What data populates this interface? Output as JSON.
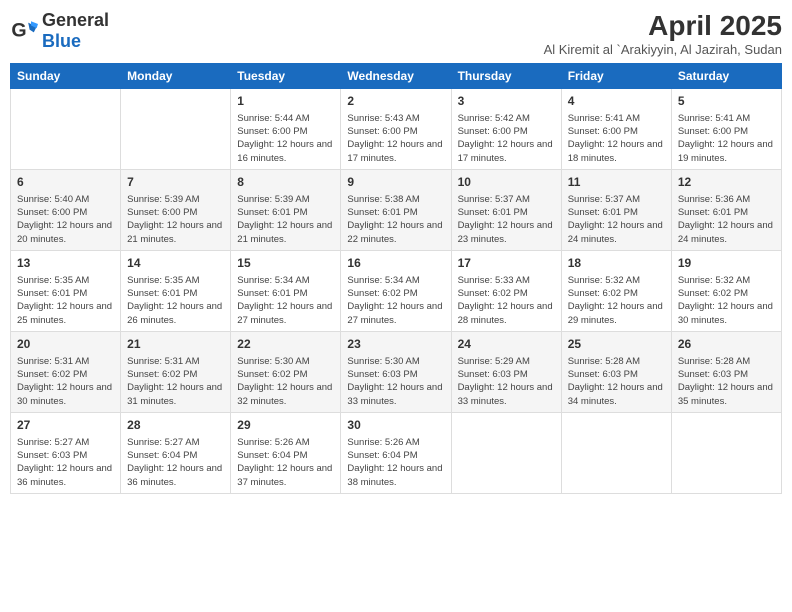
{
  "header": {
    "logo_general": "General",
    "logo_blue": "Blue",
    "month_title": "April 2025",
    "location": "Al Kiremit al `Arakiyyin, Al Jazirah, Sudan"
  },
  "weekdays": [
    "Sunday",
    "Monday",
    "Tuesday",
    "Wednesday",
    "Thursday",
    "Friday",
    "Saturday"
  ],
  "weeks": [
    [
      {
        "day": "",
        "info": ""
      },
      {
        "day": "",
        "info": ""
      },
      {
        "day": "1",
        "info": "Sunrise: 5:44 AM\nSunset: 6:00 PM\nDaylight: 12 hours and 16 minutes."
      },
      {
        "day": "2",
        "info": "Sunrise: 5:43 AM\nSunset: 6:00 PM\nDaylight: 12 hours and 17 minutes."
      },
      {
        "day": "3",
        "info": "Sunrise: 5:42 AM\nSunset: 6:00 PM\nDaylight: 12 hours and 17 minutes."
      },
      {
        "day": "4",
        "info": "Sunrise: 5:41 AM\nSunset: 6:00 PM\nDaylight: 12 hours and 18 minutes."
      },
      {
        "day": "5",
        "info": "Sunrise: 5:41 AM\nSunset: 6:00 PM\nDaylight: 12 hours and 19 minutes."
      }
    ],
    [
      {
        "day": "6",
        "info": "Sunrise: 5:40 AM\nSunset: 6:00 PM\nDaylight: 12 hours and 20 minutes."
      },
      {
        "day": "7",
        "info": "Sunrise: 5:39 AM\nSunset: 6:00 PM\nDaylight: 12 hours and 21 minutes."
      },
      {
        "day": "8",
        "info": "Sunrise: 5:39 AM\nSunset: 6:01 PM\nDaylight: 12 hours and 21 minutes."
      },
      {
        "day": "9",
        "info": "Sunrise: 5:38 AM\nSunset: 6:01 PM\nDaylight: 12 hours and 22 minutes."
      },
      {
        "day": "10",
        "info": "Sunrise: 5:37 AM\nSunset: 6:01 PM\nDaylight: 12 hours and 23 minutes."
      },
      {
        "day": "11",
        "info": "Sunrise: 5:37 AM\nSunset: 6:01 PM\nDaylight: 12 hours and 24 minutes."
      },
      {
        "day": "12",
        "info": "Sunrise: 5:36 AM\nSunset: 6:01 PM\nDaylight: 12 hours and 24 minutes."
      }
    ],
    [
      {
        "day": "13",
        "info": "Sunrise: 5:35 AM\nSunset: 6:01 PM\nDaylight: 12 hours and 25 minutes."
      },
      {
        "day": "14",
        "info": "Sunrise: 5:35 AM\nSunset: 6:01 PM\nDaylight: 12 hours and 26 minutes."
      },
      {
        "day": "15",
        "info": "Sunrise: 5:34 AM\nSunset: 6:01 PM\nDaylight: 12 hours and 27 minutes."
      },
      {
        "day": "16",
        "info": "Sunrise: 5:34 AM\nSunset: 6:02 PM\nDaylight: 12 hours and 27 minutes."
      },
      {
        "day": "17",
        "info": "Sunrise: 5:33 AM\nSunset: 6:02 PM\nDaylight: 12 hours and 28 minutes."
      },
      {
        "day": "18",
        "info": "Sunrise: 5:32 AM\nSunset: 6:02 PM\nDaylight: 12 hours and 29 minutes."
      },
      {
        "day": "19",
        "info": "Sunrise: 5:32 AM\nSunset: 6:02 PM\nDaylight: 12 hours and 30 minutes."
      }
    ],
    [
      {
        "day": "20",
        "info": "Sunrise: 5:31 AM\nSunset: 6:02 PM\nDaylight: 12 hours and 30 minutes."
      },
      {
        "day": "21",
        "info": "Sunrise: 5:31 AM\nSunset: 6:02 PM\nDaylight: 12 hours and 31 minutes."
      },
      {
        "day": "22",
        "info": "Sunrise: 5:30 AM\nSunset: 6:02 PM\nDaylight: 12 hours and 32 minutes."
      },
      {
        "day": "23",
        "info": "Sunrise: 5:30 AM\nSunset: 6:03 PM\nDaylight: 12 hours and 33 minutes."
      },
      {
        "day": "24",
        "info": "Sunrise: 5:29 AM\nSunset: 6:03 PM\nDaylight: 12 hours and 33 minutes."
      },
      {
        "day": "25",
        "info": "Sunrise: 5:28 AM\nSunset: 6:03 PM\nDaylight: 12 hours and 34 minutes."
      },
      {
        "day": "26",
        "info": "Sunrise: 5:28 AM\nSunset: 6:03 PM\nDaylight: 12 hours and 35 minutes."
      }
    ],
    [
      {
        "day": "27",
        "info": "Sunrise: 5:27 AM\nSunset: 6:03 PM\nDaylight: 12 hours and 36 minutes."
      },
      {
        "day": "28",
        "info": "Sunrise: 5:27 AM\nSunset: 6:04 PM\nDaylight: 12 hours and 36 minutes."
      },
      {
        "day": "29",
        "info": "Sunrise: 5:26 AM\nSunset: 6:04 PM\nDaylight: 12 hours and 37 minutes."
      },
      {
        "day": "30",
        "info": "Sunrise: 5:26 AM\nSunset: 6:04 PM\nDaylight: 12 hours and 38 minutes."
      },
      {
        "day": "",
        "info": ""
      },
      {
        "day": "",
        "info": ""
      },
      {
        "day": "",
        "info": ""
      }
    ]
  ]
}
